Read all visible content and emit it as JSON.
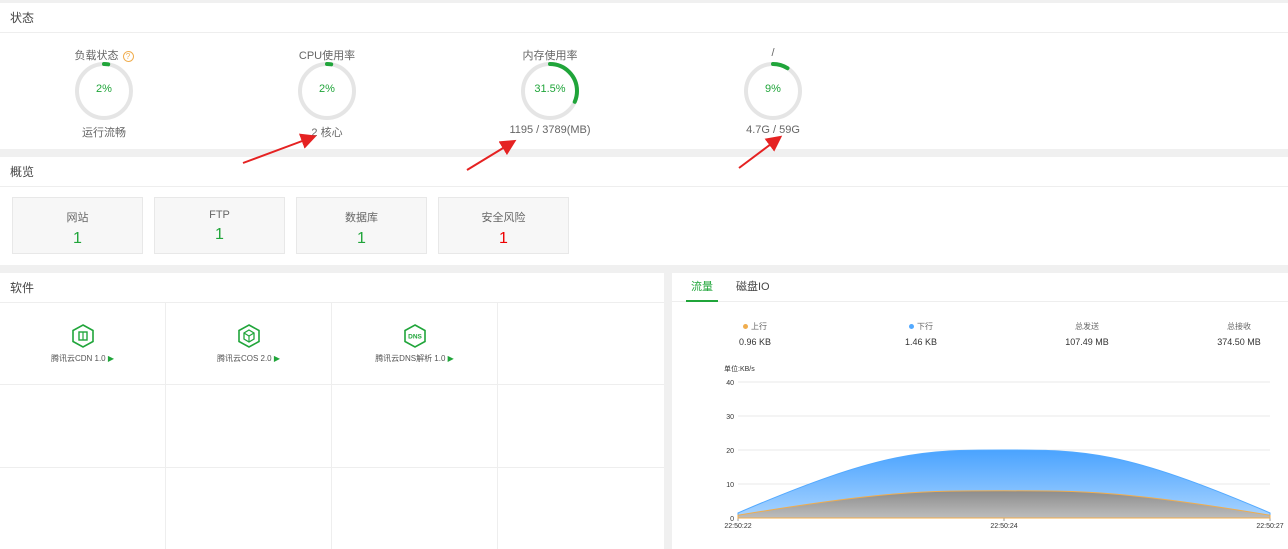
{
  "status": {
    "title": "状态",
    "gauges": [
      {
        "label": "负载状态",
        "value_text": "2%",
        "percent": 2,
        "sub": "运行流畅",
        "help": "?"
      },
      {
        "label": "CPU使用率",
        "value_text": "2%",
        "percent": 2,
        "sub": "2 核心"
      },
      {
        "label": "内存使用率",
        "value_text": "31.5%",
        "percent": 31.5,
        "sub": "1195 / 3789(MB)"
      },
      {
        "label": "/",
        "value_text": "9%",
        "percent": 9,
        "sub": "4.7G / 59G"
      }
    ]
  },
  "overview": {
    "title": "概览",
    "cards": [
      {
        "label": "网站",
        "value": "1"
      },
      {
        "label": "FTP",
        "value": "1"
      },
      {
        "label": "数据库",
        "value": "1"
      },
      {
        "label": "安全风险",
        "value": "1"
      }
    ]
  },
  "software": {
    "title": "软件",
    "items": [
      {
        "name": "腾讯云CDN 1.0",
        "icon": "cdn-icon",
        "arrow": "▶"
      },
      {
        "name": "腾讯云COS 2.0",
        "icon": "cos-icon",
        "arrow": "▶"
      },
      {
        "name": "腾讯云DNS解析 1.0",
        "icon": "dns-icon",
        "icon_text": "DNS",
        "arrow": "▶"
      }
    ]
  },
  "network": {
    "tabs": [
      {
        "label": "流量"
      },
      {
        "label": "磁盘IO"
      }
    ],
    "stats": [
      {
        "label": "上行",
        "value": "0.96 KB",
        "color": "#f0ad4e"
      },
      {
        "label": "下行",
        "value": "1.46 KB",
        "color": "#52a9ff"
      },
      {
        "label": "总发送",
        "value": "107.49 MB"
      },
      {
        "label": "总接收",
        "value": "374.50 MB"
      }
    ],
    "unit": "单位:KB/s"
  },
  "chart_data": {
    "type": "area",
    "ylabel": "单位:KB/s",
    "ylim": [
      0,
      40
    ],
    "yticks": [
      0,
      10,
      20,
      30,
      40
    ],
    "x": [
      "22:50:22",
      "22:50:24",
      "22:50:27"
    ],
    "series": [
      {
        "name": "下行",
        "values": [
          1.5,
          20,
          1.5
        ],
        "color": "#52a9ff"
      },
      {
        "name": "上行",
        "values": [
          0.8,
          8,
          0.8
        ],
        "color": "#f0ad4e"
      }
    ],
    "grid": true
  }
}
